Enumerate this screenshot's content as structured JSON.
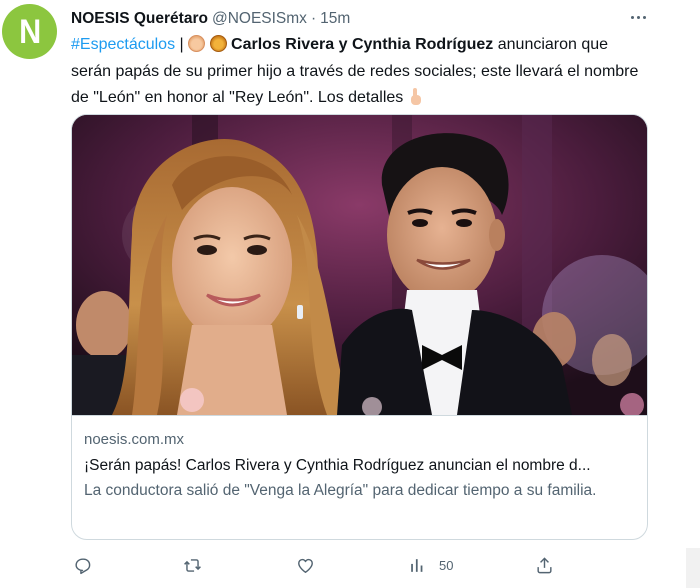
{
  "tweet": {
    "avatar_letter": "N",
    "display_name": "NOESIS Querétaro",
    "handle": "@NOESISmx",
    "separator": "·",
    "time": "15m",
    "text": {
      "hashtag": "#Espectáculos",
      "pipe": " | ",
      "emoji_1": "baby-emoji",
      "emoji_2": "lion-emoji",
      "bold_names": "Carlos Rivera y Cynthia Rodríguez",
      "body": " anunciaron que serán papás de su primer hijo a través de redes sociales; este llevará el nombre de \"León\" en honor al \"Rey León\". Los detalles ",
      "emoji_3": "pointing-down-emoji"
    },
    "card": {
      "image_alt": "Woman with long wavy hair and man in tuxedo with bow tie, smiling at an event",
      "domain": "noesis.com.mx",
      "title": "¡Serán papás! Carlos Rivera y Cynthia Rodríguez anuncian el nombre d...",
      "description": "La conductora salió de \"Venga la Alegría\" para dedicar tiempo a su familia."
    },
    "actions": {
      "reply_icon": "reply-icon",
      "retweet_icon": "retweet-icon",
      "like_icon": "heart-icon",
      "views_icon": "views-icon",
      "views_count": "50",
      "share_icon": "share-icon"
    }
  },
  "colors": {
    "brand_avatar": "#8cc63f",
    "link_blue": "#1d9bf0",
    "secondary_text": "#536471",
    "border": "#cfd9de"
  }
}
